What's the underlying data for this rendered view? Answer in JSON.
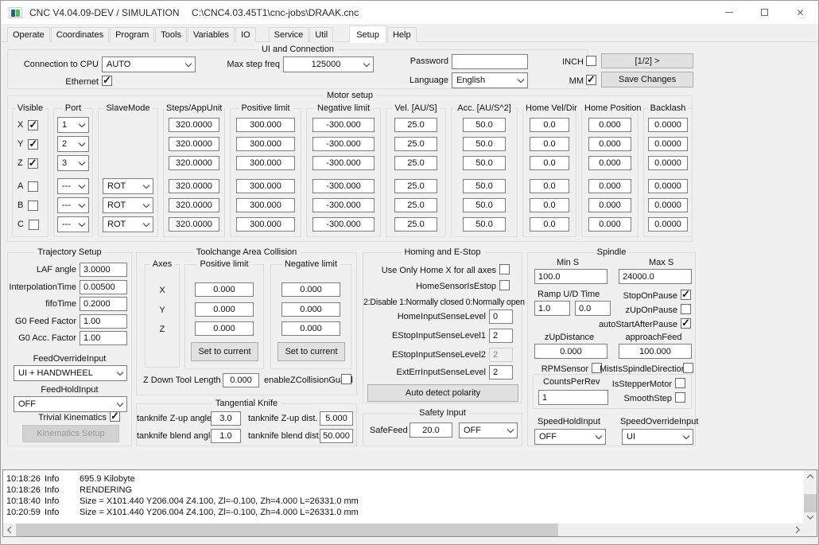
{
  "window": {
    "title": "CNC V4.04.09-DEV / SIMULATION",
    "file_path": "C:\\CNC4.03.45T1\\cnc-jobs\\DRAAK.cnc",
    "controls": [
      "minimize",
      "maximize",
      "close"
    ]
  },
  "tabs": {
    "items": [
      "Operate",
      "Coordinates",
      "Program",
      "Tools",
      "Variables",
      "IO",
      "Service",
      "Util",
      "Setup",
      "Help"
    ],
    "active": "Setup"
  },
  "ui_connection": {
    "title": "UI and Connection",
    "connection_to_cpu": {
      "label": "Connection to CPU",
      "value": "AUTO"
    },
    "ethernet": {
      "label": "Ethernet",
      "checked": true
    },
    "max_step_freq": {
      "label": "Max step freq",
      "value": "125000"
    },
    "password": {
      "label": "Password",
      "value": ""
    },
    "language": {
      "label": "Language",
      "value": "English"
    },
    "inch": {
      "label": "INCH",
      "checked": false
    },
    "mm": {
      "label": "MM",
      "checked": true
    },
    "page_button": "[1/2] >",
    "save_button": "Save Changes"
  },
  "motor_setup": {
    "title": "Motor setup",
    "columns": [
      "Visible",
      "Port",
      "SlaveMode",
      "Steps/AppUnit",
      "Positive limit",
      "Negative limit",
      "Vel. [AU/S]",
      "Acc. [AU/S^2]",
      "Home Vel/Dir",
      "Home Position",
      "Backlash"
    ],
    "rows": [
      {
        "axis": "X",
        "visible": true,
        "port": "1",
        "steps": "320.0000",
        "pos_limit": "300.000",
        "neg_limit": "-300.000",
        "vel": "25.0",
        "acc": "50.0",
        "home_vel": "0.0",
        "home_pos": "0.000",
        "backlash": "0.0000"
      },
      {
        "axis": "Y",
        "visible": true,
        "port": "2",
        "steps": "320.0000",
        "pos_limit": "300.000",
        "neg_limit": "-300.000",
        "vel": "25.0",
        "acc": "50.0",
        "home_vel": "0.0",
        "home_pos": "0.000",
        "backlash": "0.0000"
      },
      {
        "axis": "Z",
        "visible": true,
        "port": "3",
        "steps": "320.0000",
        "pos_limit": "300.000",
        "neg_limit": "-300.000",
        "vel": "25.0",
        "acc": "50.0",
        "home_vel": "0.0",
        "home_pos": "0.000",
        "backlash": "0.0000"
      },
      {
        "axis": "A",
        "visible": false,
        "port": "---",
        "slave_mode": "ROT",
        "steps": "320.0000",
        "pos_limit": "300.000",
        "neg_limit": "-300.000",
        "vel": "25.0",
        "acc": "50.0",
        "home_vel": "0.0",
        "home_pos": "0.000",
        "backlash": "0.0000"
      },
      {
        "axis": "B",
        "visible": false,
        "port": "---",
        "slave_mode": "ROT",
        "steps": "320.0000",
        "pos_limit": "300.000",
        "neg_limit": "-300.000",
        "vel": "25.0",
        "acc": "50.0",
        "home_vel": "0.0",
        "home_pos": "0.000",
        "backlash": "0.0000"
      },
      {
        "axis": "C",
        "visible": false,
        "port": "---",
        "slave_mode": "ROT",
        "steps": "320.0000",
        "pos_limit": "300.000",
        "neg_limit": "-300.000",
        "vel": "25.0",
        "acc": "50.0",
        "home_vel": "0.0",
        "home_pos": "0.000",
        "backlash": "0.0000"
      }
    ]
  },
  "trajectory": {
    "title": "Trajectory Setup",
    "fields": [
      {
        "label": "LAF angle",
        "value": "3.0000"
      },
      {
        "label": "InterpolationTime",
        "value": "0.00500"
      },
      {
        "label": "fifoTime",
        "value": "0.2000"
      },
      {
        "label": "G0 Feed Factor",
        "value": "1.00"
      },
      {
        "label": "G0 Acc. Factor",
        "value": "1.00"
      }
    ],
    "feed_override": {
      "label": "FeedOverrideInput",
      "value": "UI + HANDWHEEL"
    },
    "feed_hold": {
      "label": "FeedHoldInput",
      "value": "OFF"
    },
    "trivial_kinematics": {
      "label": "Trivial Kinematics",
      "checked": true
    },
    "kinematics_button": "Kinematics Setup"
  },
  "toolchange": {
    "title": "Toolchange Area Collision",
    "axes_label": "Axes",
    "axes": [
      "X",
      "Y",
      "Z"
    ],
    "positive": {
      "title": "Positive limit",
      "values": [
        "0.000",
        "0.000",
        "0.000"
      ],
      "button": "Set to current"
    },
    "negative": {
      "title": "Negative limit",
      "values": [
        "0.000",
        "0.000",
        "0.000"
      ],
      "button": "Set to current"
    },
    "z_down": {
      "label": "Z Down Tool Length",
      "value": "0.000"
    },
    "guard": {
      "label": "enableZCollisionGuard",
      "checked": false
    }
  },
  "tangential": {
    "title": "Tangential Knife",
    "zup_angle": {
      "label": "tanknife Z-up angle",
      "value": "3.0"
    },
    "zup_dist": {
      "label": "tanknife Z-up dist.",
      "value": "5.000"
    },
    "blend_angle": {
      "label": "tanknife blend angle",
      "value": "1.0"
    },
    "blend_dist": {
      "label": "tanknife blend dist",
      "value": "50.000"
    }
  },
  "homing": {
    "title": "Homing and E-Stop",
    "home_x_all": {
      "label": "Use Only Home X for all axes",
      "checked": false
    },
    "home_sensor_estop": {
      "label": "HomeSensorIsEstop",
      "checked": false
    },
    "sense_note": "2:Disable 1:Normally closed 0:Normally open",
    "home_input": {
      "label": "HomeInputSenseLevel",
      "value": "0"
    },
    "estop1": {
      "label": "EStopInputSenseLevel1",
      "value": "2"
    },
    "estop2": {
      "label": "EStopInputSenseLevel2",
      "value": "2",
      "disabled": true
    },
    "exterr": {
      "label": "ExtErrInputSenseLevel",
      "value": "2"
    },
    "auto_detect_button": "Auto detect polarity"
  },
  "safety": {
    "title": "Safety Input",
    "safe_feed": {
      "label": "SafeFeed",
      "value": "20.0"
    },
    "input_select": "OFF"
  },
  "spindle": {
    "title": "Spindle",
    "min_s": {
      "label": "Min S",
      "value": "100.0"
    },
    "max_s": {
      "label": "Max S",
      "value": "24000.0"
    },
    "ramp": {
      "label": "Ramp U/D Time",
      "up": "1.0",
      "down": "0.0"
    },
    "stop_on_pause": {
      "label": "StopOnPause",
      "checked": true
    },
    "zup_on_pause": {
      "label": "zUpOnPause",
      "checked": false
    },
    "auto_start": {
      "label": "autoStartAfterPause",
      "checked": true
    },
    "zup_distance": {
      "label": "zUpDistance",
      "value": "0.000"
    },
    "approach_feed": {
      "label": "approachFeed",
      "value": "100.000"
    },
    "rpm_sensor": {
      "label": "RPMSensor",
      "checked": false
    },
    "mist_dir": {
      "label": "MistIsSpindleDirection",
      "checked": false
    },
    "counts_per_rev": {
      "label": "CountsPerRev",
      "value": "1"
    },
    "is_stepper": {
      "label": "IsStepperMotor",
      "checked": false
    },
    "smooth_step": {
      "label": "SmoothStep",
      "checked": false
    },
    "speed_hold": {
      "label": "SpeedHoldInput",
      "value": "OFF"
    },
    "speed_override": {
      "label": "SpeedOverrideInput",
      "value": "UI"
    }
  },
  "log": {
    "lines": [
      {
        "time": "10:18:26",
        "level": "Info",
        "message": "695.9 Kilobyte"
      },
      {
        "time": "10:18:26",
        "level": "Info",
        "message": "RENDERING"
      },
      {
        "time": "10:18:40",
        "level": "Info",
        "message": "Size = X101.440 Y206.004 Z4.100, Zl=-0.100, Zh=4.000 L=26331.0 mm"
      },
      {
        "time": "10:20:59",
        "level": "Info",
        "message": "Size = X101.440 Y206.004 Z4.100, Zl=-0.100, Zh=4.000 L=26331.0 mm"
      }
    ]
  },
  "colors": {
    "titlebar_bg": "#ffffff",
    "panel_bg": "#f0f0f0",
    "groupbox_border": "#dcdcdc",
    "input_border": "#7f7f7f",
    "button_bg": "#e1e1e1",
    "button_border": "#adadad",
    "scroll_thumb": "#cdcdcd"
  }
}
